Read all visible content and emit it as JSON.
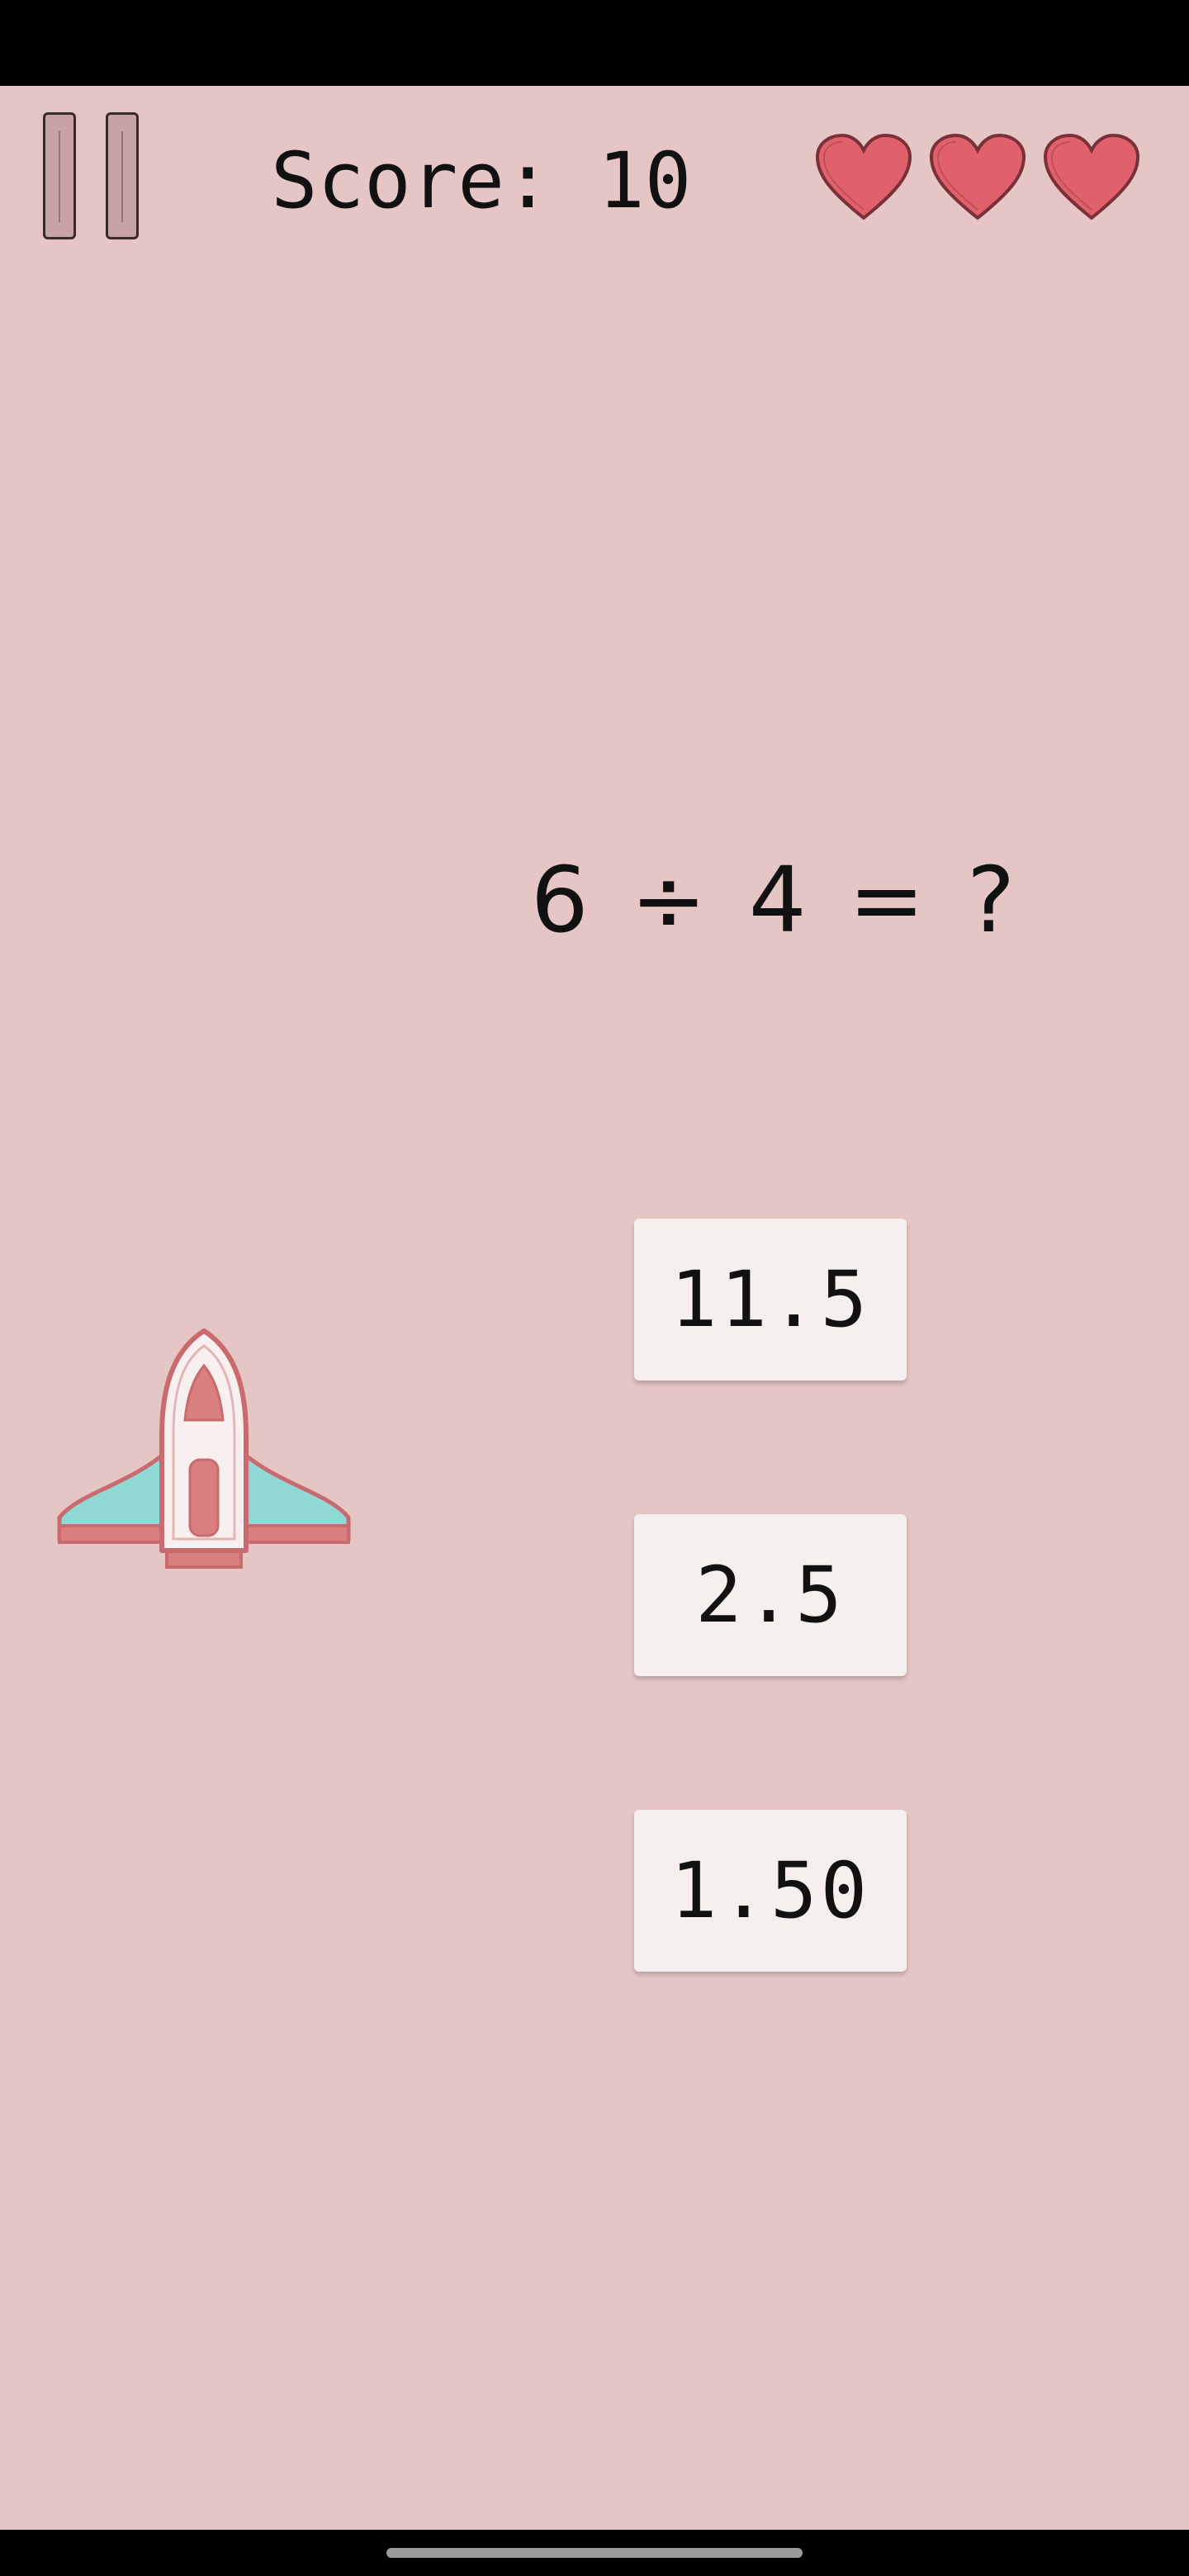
{
  "hud": {
    "score_label": "Score: 10",
    "lives": 3,
    "heart_color": "#e0616b"
  },
  "question": {
    "text": "6 ÷ 4 = ?"
  },
  "answers": [
    {
      "label": "11.5"
    },
    {
      "label": "2.5"
    },
    {
      "label": "1.50"
    }
  ],
  "colors": {
    "background": "#e6c5c5",
    "card": "#f5efee",
    "rocket_body": "#f7f0ef",
    "rocket_wing": "#8fd8d6",
    "rocket_trim": "#d97f80"
  },
  "icons": {
    "pause": "pause-icon",
    "heart": "heart-icon",
    "player": "rocket-icon"
  }
}
